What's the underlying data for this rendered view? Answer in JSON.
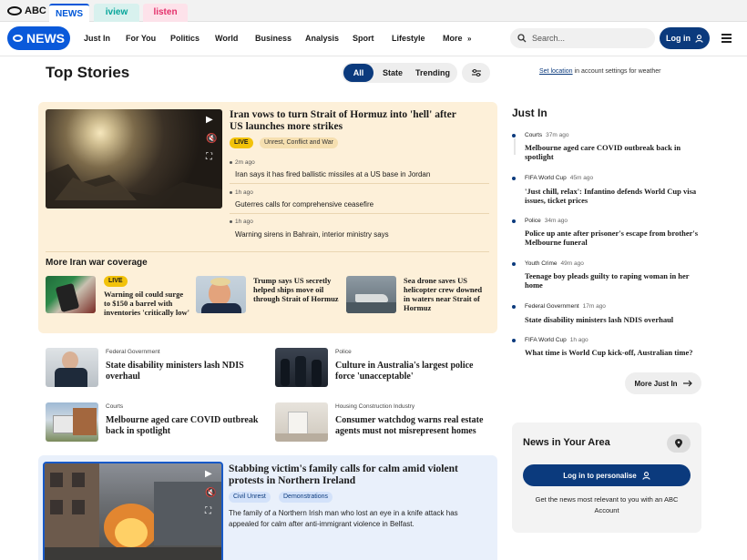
{
  "portal": {
    "brand": "ABC",
    "tabs": [
      {
        "label": "NEWS",
        "color": "#0057d8"
      },
      {
        "label": "iview",
        "color": "#05a59a"
      },
      {
        "label": "listen",
        "color": "#e4306b"
      }
    ]
  },
  "nav": {
    "logo": "NEWS",
    "items": [
      "Just In",
      "For You",
      "Politics",
      "World",
      "Business",
      "Analysis",
      "Sport",
      "Lifestyle",
      "More"
    ],
    "search_placeholder": "Search...",
    "login_label": "Log in"
  },
  "top_stories": {
    "title": "Top Stories",
    "filters": [
      "All",
      "State",
      "Trending"
    ],
    "location_link": "Set location",
    "location_text": "in account settings for weather"
  },
  "feature": {
    "headline": "Iran vows to turn Strait of Hormuz into 'hell' after US launches more strikes",
    "live_badge": "LIVE",
    "topic_badge": "Unrest, Conflict and War",
    "updates": [
      {
        "time": "2m ago",
        "text": "Iran says it has fired ballistic missiles at a US base in Jordan"
      },
      {
        "time": "1h ago",
        "text": "Guterres calls for comprehensive ceasefire"
      },
      {
        "time": "1h ago",
        "text": "Warning sirens in Bahrain, interior ministry says"
      }
    ],
    "more_heading": "More Iran war coverage",
    "more_stories": [
      {
        "badge": "LIVE",
        "title": "Warning oil could surge to $150 a barrel with inventories 'critically low'"
      },
      {
        "title": "Trump says US secretly helped ships move oil through Strait of Hormuz"
      },
      {
        "title": "Sea drone saves US helicopter crew downed in waters near Strait of Hormuz"
      }
    ]
  },
  "stories": [
    {
      "label": "Federal Government",
      "title": "State disability ministers lash NDIS overhaul"
    },
    {
      "label": "Police",
      "title": "Culture in Australia's largest police force 'unacceptable'"
    },
    {
      "label": "Courts",
      "title": "Melbourne aged care COVID outbreak back in spotlight"
    },
    {
      "label": "Housing Construction Industry",
      "title": "Consumer watchdog warns real estate agents must not misrepresent homes"
    }
  ],
  "feature2": {
    "headline": "Stabbing victim's family calls for calm amid violent protests in Northern Ireland",
    "tags": [
      "Civil Unrest",
      "Demonstrations"
    ],
    "body": "The family of a Northern Irish man who lost an eye in a knife attack has appealed for calm after anti-immigrant violence in Belfast."
  },
  "just_in": {
    "title": "Just In",
    "items": [
      {
        "category": "Courts",
        "time": "37m ago",
        "headline": "Melbourne aged care COVID outbreak back in spotlight"
      },
      {
        "category": "FIFA World Cup",
        "time": "45m ago",
        "headline": "'Just chill, relax': Infantino defends World Cup visa issues, ticket prices"
      },
      {
        "category": "Police",
        "time": "34m ago",
        "headline": "Police up ante after prisoner's escape from brother's Melbourne funeral"
      },
      {
        "category": "Youth Crime",
        "time": "49m ago",
        "headline": "Teenage boy pleads guilty to raping woman in her home"
      },
      {
        "category": "Federal Government",
        "time": "17m ago",
        "headline": "State disability ministers lash NDIS overhaul"
      },
      {
        "category": "FIFA World Cup",
        "time": "1h ago",
        "headline": "What time is World Cup kick-off, Australian time?"
      }
    ],
    "more_label": "More Just In"
  },
  "news_in_area": {
    "title": "News in Your Area",
    "button": "Log in to personalise",
    "text": "Get the news most relevant to you with an ABC Account"
  }
}
